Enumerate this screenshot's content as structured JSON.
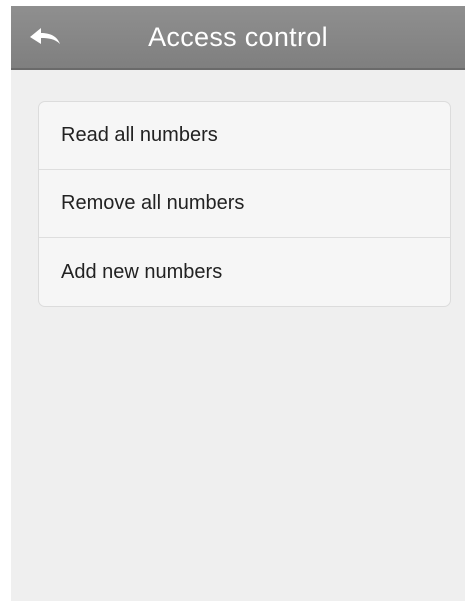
{
  "header": {
    "title": "Access control",
    "back_icon": "back-arrow-icon"
  },
  "menu": {
    "items": [
      {
        "label": "Read all numbers"
      },
      {
        "label": "Remove all numbers"
      },
      {
        "label": "Add new numbers"
      }
    ]
  },
  "colors": {
    "navbar": "#888888",
    "background": "#efefef",
    "title_text": "#ffffff",
    "item_text": "#222222"
  }
}
